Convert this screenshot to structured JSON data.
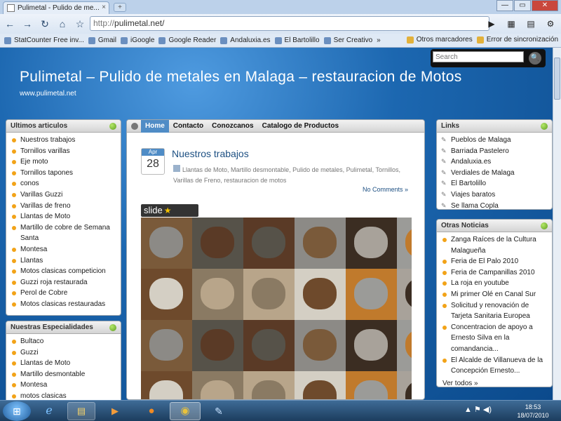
{
  "browser": {
    "tab_title": "Pulimetal - Pulido de me...",
    "tab_close": "×",
    "new_tab": "+",
    "window_buttons": [
      "—",
      "▭",
      "✕"
    ],
    "url_protocol": "http://",
    "url_host": "pulimetal.net/",
    "bookmarks": [
      "StatCounter Free inv...",
      "Gmail",
      "iGoogle",
      "Google Reader",
      "Andaluxia.es",
      "El Bartolillo",
      "Ser Creativo"
    ],
    "bookmarks_more": "»",
    "bookmarks_right": [
      "Otros marcadores",
      "Error de sincronización"
    ]
  },
  "site": {
    "search_placeholder": "Search",
    "title": "Pulimetal – Pulido de metales en Malaga – restauracion de Motos",
    "url": "www.pulimetal.net"
  },
  "left": {
    "ultimos": {
      "title": "Ultimos articulos",
      "items": [
        "Nuestros trabajos",
        "Tornillos varillas",
        "Eje moto",
        "Tornillos tapones",
        "conos",
        "Varillas Guzzi",
        "Varillas de freno",
        "Llantas de Moto",
        "Martillo de cobre de Semana Santa",
        "Montesa",
        "Llantas",
        "Motos clasicas competicion",
        "Guzzi roja restaurada",
        "Perol de Cobre",
        "Motos clasicas restauradas"
      ]
    },
    "especialidades": {
      "title": "Nuestras Especialidades",
      "items": [
        "Bultaco",
        "Guzzi",
        "Llantas de Moto",
        "Martillo desmontable",
        "Montesa",
        "motos clasicas"
      ]
    }
  },
  "menu": [
    "Home",
    "Contacto",
    "Conozcanos",
    "Catalogo de Productos"
  ],
  "post": {
    "month": "Apr",
    "day": "28",
    "title": "Nuestros trabajos",
    "tags": "Llantas de Moto, Martillo desmontable, Pulido de metales, Pulimetal, Tornillos, Varillas de Freno, restauracion de motos",
    "comments": "No Comments »",
    "slide_label": "slide"
  },
  "right": {
    "links": {
      "title": "Links",
      "items": [
        "Pueblos de Malaga",
        "Barriada Pastelero",
        "Andaluxia.es",
        "Verdiales de Malaga",
        "El Bartolillo",
        "Viajes baratos",
        "Se llama Copla"
      ]
    },
    "noticias": {
      "title": "Otras Noticias",
      "items": [
        "Zanga Raíces de la Cultura Malagueña",
        "Feria de El Palo 2010",
        "Feria de Campanillas 2010",
        "La roja en youtube",
        "Mi primer Olé en Canal Sur",
        "Solicitud y renovación de Tarjeta Sanitaria Europea",
        "Concentracion de apoyo a Ernesto Silva en la comandancia...",
        "El Alcalde de Villanueva de la Concepción Ernesto..."
      ],
      "more": "Ver todos »"
    }
  },
  "taskbar": {
    "time": "18:53",
    "date": "18/07/2010"
  },
  "colors": {
    "accent": "#4f8cc6",
    "bullet": "#f2a318",
    "background": "#1a5d9c"
  }
}
